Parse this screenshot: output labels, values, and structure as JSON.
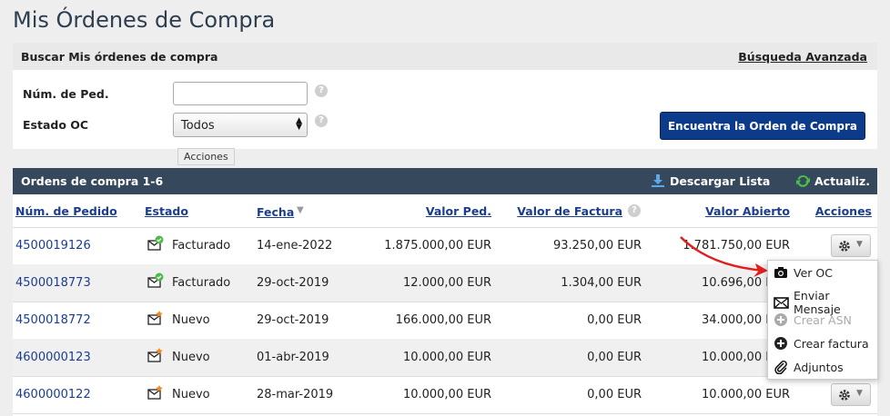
{
  "page": {
    "title": "Mis Órdenes de Compra"
  },
  "search": {
    "heading": "Buscar Mis órdenes de compra",
    "advanced_link": "Búsqueda Avanzada",
    "order_num_label": "Núm. de Ped.",
    "order_num_value": "",
    "status_label": "Estado OC",
    "status_selected": "Todos",
    "find_button": "Encuentra la Orden de Compra",
    "tooltip": "Acciones"
  },
  "results": {
    "heading": "Ordens de compra 1-6",
    "download_label": "Descargar Lista",
    "refresh_label": "Actualiz.",
    "columns": {
      "order_num": "Núm. de Pedido",
      "status": "Estado",
      "date": "Fecha",
      "order_value": "Valor Ped.",
      "invoice_value": "Valor de Factura",
      "open_value": "Valor Abierto",
      "actions": "Acciones"
    },
    "rows": [
      {
        "order_num": "4500019126",
        "status": "Facturado",
        "date": "14-ene-2022",
        "order_value": "1.875.000,00 EUR",
        "invoice_value": "93.250,00 EUR",
        "open_value": "1.781.750,00 EUR",
        "status_icon": "envelope-check-icon"
      },
      {
        "order_num": "4500018773",
        "status": "Facturado",
        "date": "29-oct-2019",
        "order_value": "12.000,00 EUR",
        "invoice_value": "1.304,00 EUR",
        "open_value": "10.696,00 EUR",
        "status_icon": "envelope-check-icon"
      },
      {
        "order_num": "4500018772",
        "status": "Nuevo",
        "date": "29-oct-2019",
        "order_value": "166.000,00 EUR",
        "invoice_value": "0,00 EUR",
        "open_value": "34.000,00 EUR",
        "status_icon": "envelope-new-icon"
      },
      {
        "order_num": "4600000123",
        "status": "Nuevo",
        "date": "01-abr-2019",
        "order_value": "10.000,00 EUR",
        "invoice_value": "0,00 EUR",
        "open_value": "10.000,00 EUR",
        "status_icon": "envelope-new-icon"
      },
      {
        "order_num": "4600000122",
        "status": "Nuevo",
        "date": "28-mar-2019",
        "order_value": "10.000,00 EUR",
        "invoice_value": "0,00 EUR",
        "open_value": "10.000,00 EUR",
        "status_icon": "envelope-new-icon"
      }
    ]
  },
  "actions_menu": {
    "items": [
      {
        "label": "Ver OC",
        "icon": "camera-icon",
        "enabled": true
      },
      {
        "label": "Enviar Mensaje",
        "icon": "envelope-icon",
        "enabled": true
      },
      {
        "label": "Crear ASN",
        "icon": "plus-circle-icon",
        "enabled": false
      },
      {
        "label": "Crear factura",
        "icon": "plus-circle-icon",
        "enabled": true
      },
      {
        "label": "Adjuntos",
        "icon": "paperclip-icon",
        "enabled": true
      }
    ]
  },
  "colors": {
    "header_bg": "#36485c",
    "link": "#1a3d8f",
    "button": "#0d3b8c",
    "annotation_arrow": "#e02020"
  }
}
